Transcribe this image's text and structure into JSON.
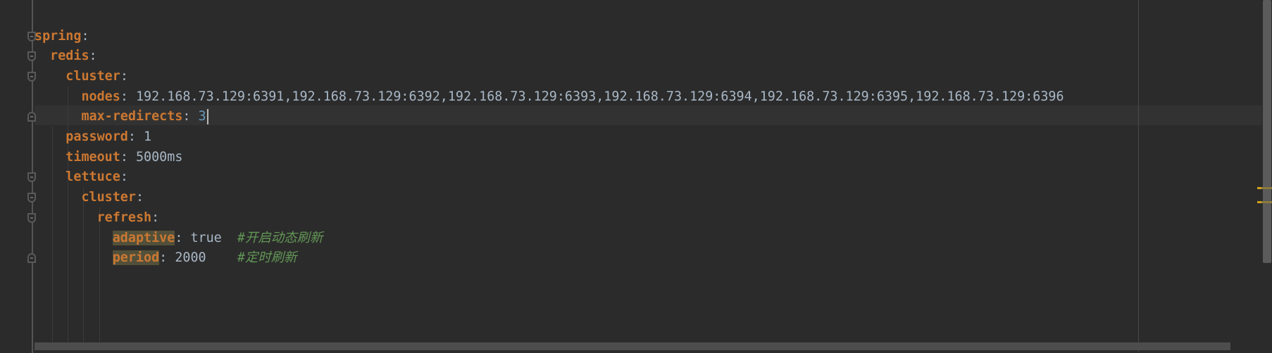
{
  "editor": {
    "language": "yaml",
    "colors": {
      "background": "#2b2b2b",
      "key": "#cc7832",
      "value": "#a9b7c6",
      "number": "#6897bb",
      "comment": "#629755",
      "key_highlight": "#52503a"
    },
    "current_line": 4,
    "lines": [
      {
        "indent": 0,
        "key": "spring",
        "fold": "open"
      },
      {
        "indent": 1,
        "key": "redis",
        "fold": "open"
      },
      {
        "indent": 2,
        "key": "cluster",
        "fold": "open"
      },
      {
        "indent": 3,
        "key": "nodes",
        "value": "192.168.73.129:6391,192.168.73.129:6392,192.168.73.129:6393,192.168.73.129:6394,192.168.73.129:6395,192.168.73.129:6396"
      },
      {
        "indent": 3,
        "key": "max-redirects",
        "value": "3",
        "value_type": "number",
        "caret": true,
        "fold": "close"
      },
      {
        "indent": 2,
        "key": "password",
        "value": "1"
      },
      {
        "indent": 2,
        "key": "timeout",
        "value": "5000ms"
      },
      {
        "indent": 2,
        "key": "lettuce",
        "fold": "open"
      },
      {
        "indent": 3,
        "key": "cluster",
        "fold": "open"
      },
      {
        "indent": 4,
        "key": "refresh",
        "fold": "open"
      },
      {
        "indent": 5,
        "key": "adaptive",
        "value": "true",
        "comment": "#开启动态刷新",
        "highlight": true
      },
      {
        "indent": 5,
        "key": "period",
        "value": "2000",
        "comment": "#定时刷新",
        "highlight": true,
        "fold": "close",
        "pad": "    "
      }
    ]
  }
}
